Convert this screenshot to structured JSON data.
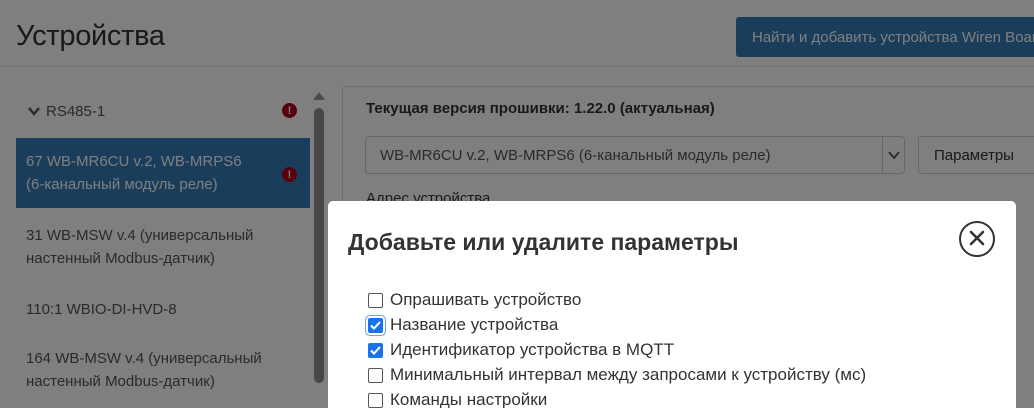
{
  "page": {
    "title": "Устройства",
    "scan_button_label": "Найти и добавить устройства Wiren Board"
  },
  "sidebar": {
    "port": {
      "label": "RS485-1",
      "has_error": true,
      "expanded": true
    },
    "devices": [
      {
        "line1": "67 WB-MR6CU v.2, WB-MRPS6",
        "line2": "(6-канальный модуль реле)",
        "active": true,
        "has_error": true
      },
      {
        "line1": "31 WB-MSW v.4 (универсальный",
        "line2": "настенный Modbus-датчик)",
        "active": false,
        "has_error": false
      },
      {
        "line1": "110:1 WBIO-DI-HVD-8",
        "line2": "",
        "active": false,
        "has_error": false
      },
      {
        "line1": "164 WB-MSW v.4 (универсальный",
        "line2": "настенный Modbus-датчик)",
        "active": false,
        "has_error": false
      }
    ]
  },
  "main": {
    "firmware_text": "Текущая версия прошивки: 1.22.0 (актуальная)",
    "device_type_selected": "WB-MR6CU v.2, WB-MRPS6 (6-канальный модуль реле)",
    "params_button_label": "Параметры",
    "address_label": "Адрес устройства"
  },
  "modal": {
    "title": "Добавьте или удалите параметры",
    "options": [
      {
        "label": "Опрашивать устройство",
        "checked": false
      },
      {
        "label": "Название устройства",
        "checked": true
      },
      {
        "label": "Идентификатор устройства в MQTT",
        "checked": true
      },
      {
        "label": "Минимальный интервал между запросами к устройству (мс)",
        "checked": false
      },
      {
        "label": "Команды настройки",
        "checked": false
      }
    ]
  },
  "colors": {
    "primary": "#337ab7",
    "error": "#b00020",
    "checkbox_checked": "#1a73e8"
  },
  "icons": {
    "close": "close-circle-icon",
    "error": "exclamation-circle-icon",
    "expand": "chevron-down-icon",
    "check": "check-icon"
  }
}
